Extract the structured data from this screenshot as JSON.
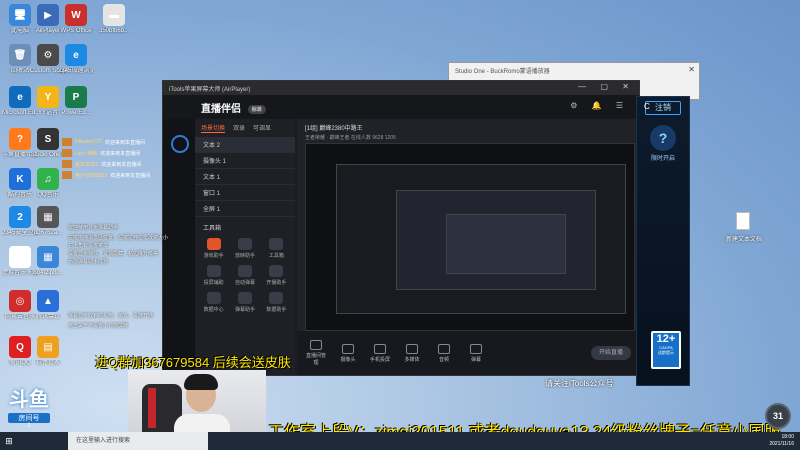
{
  "desktop_icons": [
    {
      "label": "此电脑",
      "color": "#3a86d9",
      "glyph": "🖥"
    },
    {
      "label": "AirPlayer",
      "color": "#3b6bb8",
      "glyph": "▶"
    },
    {
      "label": "WPS Office",
      "color": "#c9302c",
      "glyph": "W"
    },
    {
      "label": "350bfb6b...",
      "color": "#e4e4e4",
      "glyph": "▬"
    },
    {
      "label": "回收站",
      "color": "#6c8fb8",
      "glyph": "🗑"
    },
    {
      "label": "Custom Shop",
      "color": "#4a4a4a",
      "glyph": "⚙"
    },
    {
      "label": "2345加速浏览器",
      "color": "#1e88e5",
      "glyph": "e"
    },
    {
      "label": "Microsoft Edge",
      "color": "#0f6cbd",
      "glyph": "e"
    },
    {
      "label": "YY语音",
      "color": "#f2b618",
      "glyph": "Y"
    },
    {
      "label": "PowerEd...",
      "color": "#1a7a4a",
      "glyph": "P"
    },
    {
      "label": "斗鱼直播伴侣",
      "color": "#ff7a1a",
      "glyph": "?"
    },
    {
      "label": "Studio One 4",
      "color": "#333333",
      "glyph": "S"
    },
    {
      "label": "酷狗音乐",
      "color": "#1e6fd9",
      "glyph": "K"
    },
    {
      "label": "QQ音乐",
      "color": "#2fb34a",
      "glyph": "♫"
    },
    {
      "label": "2345安全卫士",
      "color": "#1e88e5",
      "glyph": "2"
    },
    {
      "label": "8b6762a...",
      "color": "#555555",
      "glyph": "▦"
    },
    {
      "label": "虚拟音乐多媒体管理工具",
      "color": "#ffffff",
      "glyph": "♪"
    },
    {
      "label": "6b4f2ip8i...",
      "color": "#3a86d9",
      "glyph": "▦"
    },
    {
      "label": "网易云音乐",
      "color": "#d12b2b",
      "glyph": "◎"
    },
    {
      "label": "腾讯会议",
      "color": "#2a6ed9",
      "glyph": "▲"
    },
    {
      "label": "腾讯QQ",
      "color": "#e02020",
      "glyph": "Q"
    },
    {
      "label": "软件管家",
      "color": "#f0a020",
      "glyph": "▤"
    }
  ],
  "bg_window": {
    "title": "Studio One - BuckRomo蒙语播放器"
  },
  "main_window": {
    "title": "iTools苹果屏幕大师 (AirPlayer)",
    "app_name": "直播伴侣",
    "app_badge": "标准",
    "panel_tabs": [
      "场景切换",
      "双录",
      "可调显"
    ],
    "scenes": [
      "文本 2",
      "摄像头 1",
      "文本 1",
      "窗口 1",
      "全屏 1"
    ],
    "tools_title": "工具箱",
    "tools": [
      "游戏助手",
      "放映助手",
      "工具箱",
      "投屏辅助",
      "自动弹幕",
      "开播助手",
      "数据中心",
      "弹幕助手",
      "数据助手"
    ],
    "room_title": "[1组] 巅峰2380中路王",
    "room_sub": "王者荣耀 · 巅峰王者  在线人数 9628  1205",
    "bottom_buttons": [
      "直播间管理",
      "摄像头",
      "手机投屏",
      "多媒体",
      "音频",
      "弹幕"
    ],
    "start_label": "开始直播",
    "viewer_count": "1400564"
  },
  "side_panel": {
    "letter": "C",
    "register": "注销",
    "help_icon": "?",
    "help_label": "限时开启",
    "age_rating": "12+",
    "age_sub": "CADPA",
    "age_note": "适龄提示"
  },
  "desktop_file": {
    "label": "新建文本文档"
  },
  "chat_messages": [
    {
      "user": "lrlileaton727",
      "text": "欢迎来到本直播间"
    },
    {
      "user": "Lbr小神殿",
      "text": "欢迎来到本直播间"
    },
    {
      "user": "金年华321",
      "text": "欢迎来到本直播间"
    },
    {
      "user": "用户90065551",
      "text": "欢迎来到本直播间"
    }
  ],
  "chat_hints": [
    "欢迎使用斗鱼弹幕助手",
    "左键拖拽消息区位置，左键拉伸拉框改变大小",
    "右上角有设置菜单",
    "设置显示特效、置顶隐藏、粘边降升级等",
    "添加弹幕助手成功",
    "弹幕显示收到的礼物、鱼丸、贵族开通",
    "点击关于可设置小礼物屏蔽"
  ],
  "qq_overlay": "进Q群加367679584  后续会送皮肤",
  "work_overlay": "工作室上段V：zimei201511 或者doudouya13   24级粉丝牌子=任意小国服",
  "wechat_note": "请关注iTools公众号",
  "douyu": {
    "logo": "斗鱼",
    "room_label": "房间号",
    "room_number": "1"
  },
  "counter": "31",
  "taskbar": {
    "search_placeholder": "在这里输入进行搜索",
    "time": "18:00",
    "date": "2021/11/16"
  },
  "colors": {
    "accent_orange": "#ff6a3d",
    "overlay_yellow": "#ffe600",
    "side_blue": "#3ea2ff"
  }
}
